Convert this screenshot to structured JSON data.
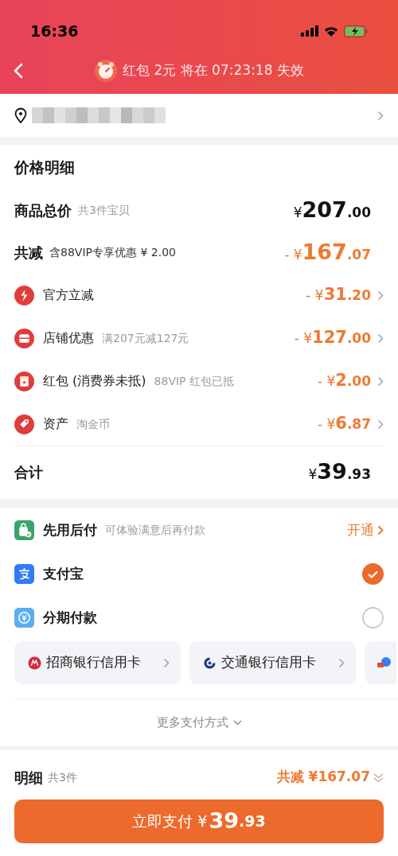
{
  "status_bar": {
    "time": "16:36",
    "charging": true
  },
  "header": {
    "notice": "红包 2元 将在 07:23:18 失效"
  },
  "address": {
    "blurred": true
  },
  "price_detail": {
    "title": "价格明细",
    "total": {
      "label": "商品总价",
      "note": "共3件宝贝",
      "currency": "¥",
      "whole": "207",
      "cents": ".00"
    },
    "discount": {
      "label": "共减",
      "note": "含88VIP专享优惠 ¥ 2.00",
      "currency": "- ¥",
      "whole": "167",
      "cents": ".07"
    },
    "items": [
      {
        "kind": "bolt",
        "label": "官方立减",
        "currency": "- ¥",
        "whole": "31",
        "cents": ".20"
      },
      {
        "kind": "shop",
        "label": "店铺优惠",
        "note": "满207元减127元",
        "currency": "- ¥",
        "whole": "127",
        "cents": ".00"
      },
      {
        "kind": "envelope",
        "label": "红包 (消费券未抵)",
        "note": "88VIP 红包已抵",
        "currency": "- ¥",
        "whole": "2",
        "cents": ".00"
      },
      {
        "kind": "tag",
        "label": "资产",
        "note": "淘金币",
        "currency": "- ¥",
        "whole": "6",
        "cents": ".87"
      }
    ],
    "sum": {
      "label": "合计",
      "currency": "¥",
      "whole": "39",
      "cents": ".93"
    }
  },
  "payment": {
    "options": [
      {
        "kind": "activate",
        "label": "先用后付",
        "note": "可体验满意后再付款",
        "action": "开通"
      },
      {
        "kind": "radio",
        "label": "支付宝",
        "selected": true
      },
      {
        "kind": "radio",
        "label": "分期付款",
        "selected": false
      }
    ],
    "cards": [
      {
        "kind": "card",
        "label": "招商银行信用卡"
      },
      {
        "kind": "card",
        "label": "交通银行信用卡"
      },
      {
        "kind": "partial"
      }
    ],
    "more": "更多支付方式"
  },
  "footer": {
    "label": "明细",
    "count": "共3件",
    "saving": "共减 ¥167.07",
    "pay_label": "立即支付 ¥",
    "pay_whole": "39",
    "pay_cents": ".93"
  }
}
